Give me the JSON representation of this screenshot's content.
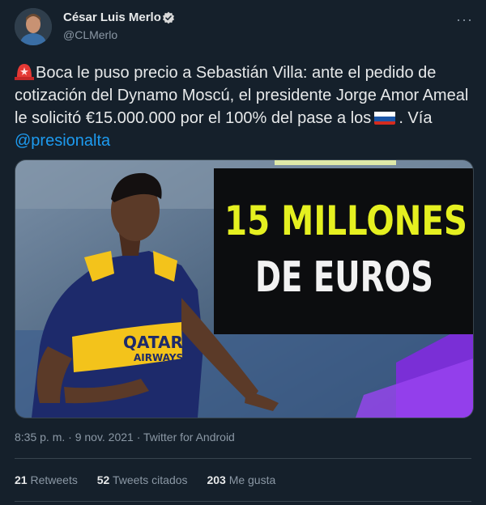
{
  "author": {
    "name": "César Luis Merlo",
    "handle": "@CLMerlo"
  },
  "tweet": {
    "text_part1": "Boca le puso precio a Sebastián Villa: ante el pedido de cotización del Dynamo Moscú, el presidente Jorge Amor Ameal le solicitó €15.000.000 por el 100% del pase a los",
    "text_part2": ". Vía",
    "mention": "@presionalta",
    "icons": [
      "siren-emoji",
      "russia-flag-emoji"
    ]
  },
  "media": {
    "headline_line1": "15 MILLONES",
    "headline_line2": "DE EUROS",
    "jersey_text_1": "QATAR",
    "jersey_text_2": "AIRWAYS"
  },
  "meta": {
    "timestamp": "8:35 p. m. · 9 nov. 2021 · Twitter for Android"
  },
  "stats": {
    "retweets_count": "21",
    "retweets_label": "Retweets",
    "quotes_count": "52",
    "quotes_label": "Tweets citados",
    "likes_count": "203",
    "likes_label": "Me gusta"
  },
  "colors": {
    "background": "#15202b",
    "link": "#1d9bf0",
    "muted": "#8b98a5",
    "headline_yellow": "#e5f020"
  }
}
